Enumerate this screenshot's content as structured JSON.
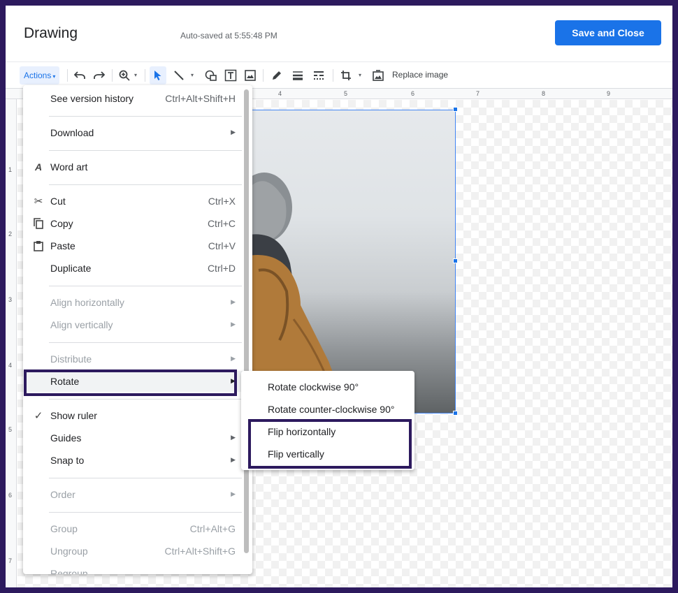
{
  "header": {
    "title": "Drawing",
    "autosave": "Auto-saved at 5:55:48 PM",
    "save_close_label": "Save and Close"
  },
  "toolbar": {
    "actions_label": "Actions",
    "replace_image_label": "Replace image",
    "icons": [
      "undo-icon",
      "redo-icon",
      "zoom-icon",
      "select-icon",
      "line-icon",
      "shape-icon",
      "textbox-icon",
      "image-icon",
      "pen-icon",
      "line-weight-icon",
      "line-dash-icon",
      "crop-icon",
      "replace-image-icon"
    ]
  },
  "ruler": {
    "top": [
      "4",
      "5",
      "6",
      "7",
      "8",
      "9"
    ],
    "left": [
      "1",
      "2",
      "3",
      "4",
      "5",
      "6",
      "7"
    ]
  },
  "menu": {
    "items": [
      {
        "label": "See version history",
        "shortcut": "Ctrl+Alt+Shift+H"
      },
      {
        "label": "Download"
      },
      {
        "label": "Word art"
      },
      {
        "label": "Cut",
        "shortcut": "Ctrl+X"
      },
      {
        "label": "Copy",
        "shortcut": "Ctrl+C"
      },
      {
        "label": "Paste",
        "shortcut": "Ctrl+V"
      },
      {
        "label": "Duplicate",
        "shortcut": "Ctrl+D"
      },
      {
        "label": "Align horizontally"
      },
      {
        "label": "Align vertically"
      },
      {
        "label": "Distribute"
      },
      {
        "label": "Rotate"
      },
      {
        "label": "Show ruler"
      },
      {
        "label": "Guides"
      },
      {
        "label": "Snap to"
      },
      {
        "label": "Order"
      },
      {
        "label": "Group",
        "shortcut": "Ctrl+Alt+G"
      },
      {
        "label": "Ungroup",
        "shortcut": "Ctrl+Alt+Shift+G"
      },
      {
        "label": "Regroup"
      }
    ]
  },
  "submenu": {
    "items": [
      {
        "label": "Rotate clockwise 90°"
      },
      {
        "label": "Rotate counter-clockwise 90°"
      },
      {
        "label": "Flip horizontally"
      },
      {
        "label": "Flip vertically"
      }
    ]
  },
  "colors": {
    "accent": "#1a73e8",
    "highlight_box": "#2d1a5e"
  }
}
